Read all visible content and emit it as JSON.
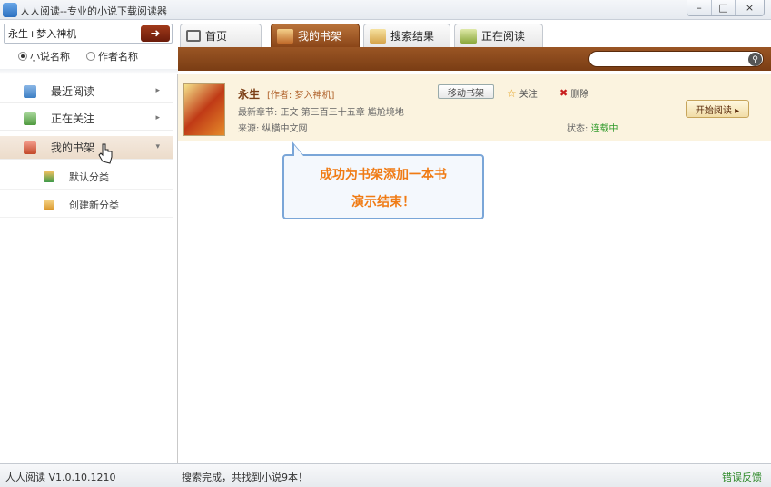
{
  "window": {
    "title": "人人阅读--专业的小说下载阅读器",
    "minimize": "–",
    "maximize": "□",
    "close": "×"
  },
  "search": {
    "value": "永生+梦入神机",
    "go_icon": "arrow-right-icon",
    "options": [
      {
        "label": "小说名称",
        "selected": true
      },
      {
        "label": "作者名称",
        "selected": false
      }
    ]
  },
  "sidebar": {
    "items": [
      {
        "label": "最近阅读",
        "icon": "recent-read-icon",
        "arrow": "▸"
      },
      {
        "label": "正在关注",
        "icon": "following-icon",
        "arrow": "▸"
      },
      {
        "label": "我的书架",
        "icon": "bookshelf-icon",
        "arrow": "▾",
        "active": true
      }
    ],
    "subitems": [
      {
        "label": "默认分类",
        "icon": "books-icon"
      },
      {
        "label": "创建新分类",
        "icon": "new-category-icon"
      }
    ]
  },
  "tabs": [
    {
      "label": "首页",
      "icon": "home-icon",
      "active": false
    },
    {
      "label": "我的书架",
      "icon": "bookshelf-icon",
      "active": true
    },
    {
      "label": "搜索结果",
      "icon": "search-results-icon",
      "active": false
    },
    {
      "label": "正在阅读",
      "icon": "reading-icon",
      "active": false
    }
  ],
  "toolbar": {
    "search_placeholder": "",
    "search_icon": "search-icon"
  },
  "book": {
    "title": "永生",
    "author": "[作者: 梦入神机]",
    "latest_chapter": "最新章节: 正文 第三百三十五章  尴尬境地",
    "source": "来源: 纵横中文网",
    "move_label": "移动书架",
    "follow_label": "关注",
    "delete_label": "删除",
    "status_label": "状态:",
    "status_value": "连载中",
    "read_label": "开始阅读 ▸"
  },
  "callout": {
    "line1": "成功为书架添加一本书",
    "line2": "演示结束！"
  },
  "statusbar": {
    "version": "人人阅读 V1.0.10.1210",
    "message": "搜索完成，共找到小说9本！",
    "feedback": "错误反馈"
  },
  "colors": {
    "accent_brown": "#8a4518",
    "highlight_row": "#fbf3df",
    "callout_text": "#f07b14",
    "status_green": "#2f9a2a"
  }
}
